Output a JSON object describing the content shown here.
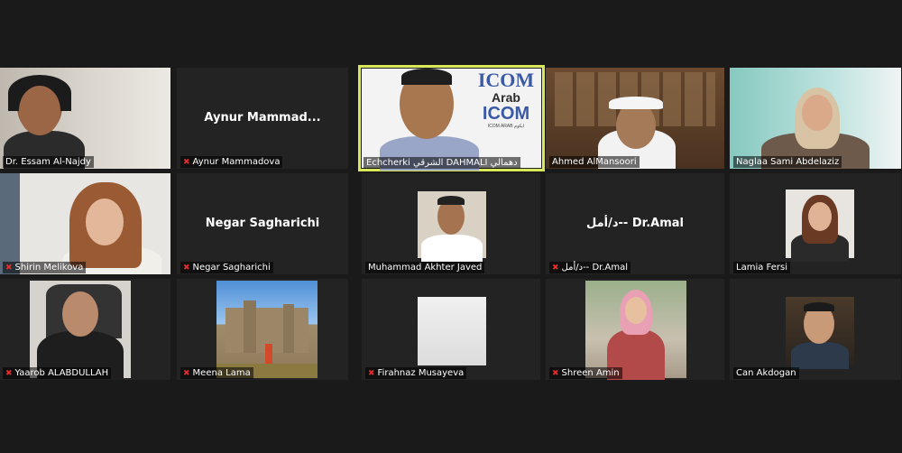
{
  "participants": [
    {
      "name": "Dr. Essam Al-Najdy",
      "muted": false
    },
    {
      "name": "Aynur Mammadova",
      "display": "Aynur  Mammad...",
      "muted": true
    },
    {
      "name": "Echcherki الشرقي DAHMALI دهمالي",
      "muted": false,
      "active": true,
      "logo": {
        "line1": "ICOM",
        "line2": "Arab",
        "line3": "ICOM",
        "sub": "ICOM ARAB ايكوم"
      }
    },
    {
      "name": "Ahmed AlMansoori",
      "muted": false
    },
    {
      "name": "Naglaa Sami Abdelaziz",
      "muted": false
    },
    {
      "name": "Shirin Melikova",
      "muted": true
    },
    {
      "name": "Negar Sagharichi",
      "display": "Negar Sagharichi",
      "muted": true
    },
    {
      "name": "Muhammad Akhter Javed",
      "muted": false
    },
    {
      "name": "د/أمل-- Dr.Amal",
      "display": "د/أمل-- Dr.Amal",
      "muted": true
    },
    {
      "name": "Lamia Fersi",
      "muted": false
    },
    {
      "name": "Yaarob ALABDULLAH",
      "muted": true
    },
    {
      "name": "Meena Lama",
      "muted": true
    },
    {
      "name": "Firahnaz Musayeva",
      "muted": true
    },
    {
      "name": "Shreen Amin",
      "muted": true
    },
    {
      "name": "Can Akdogan",
      "muted": false
    }
  ],
  "colors": {
    "background": "#1a1a1a",
    "tile": "#232323",
    "active_border": "#d8e85a",
    "mute": "#e02d2d"
  }
}
